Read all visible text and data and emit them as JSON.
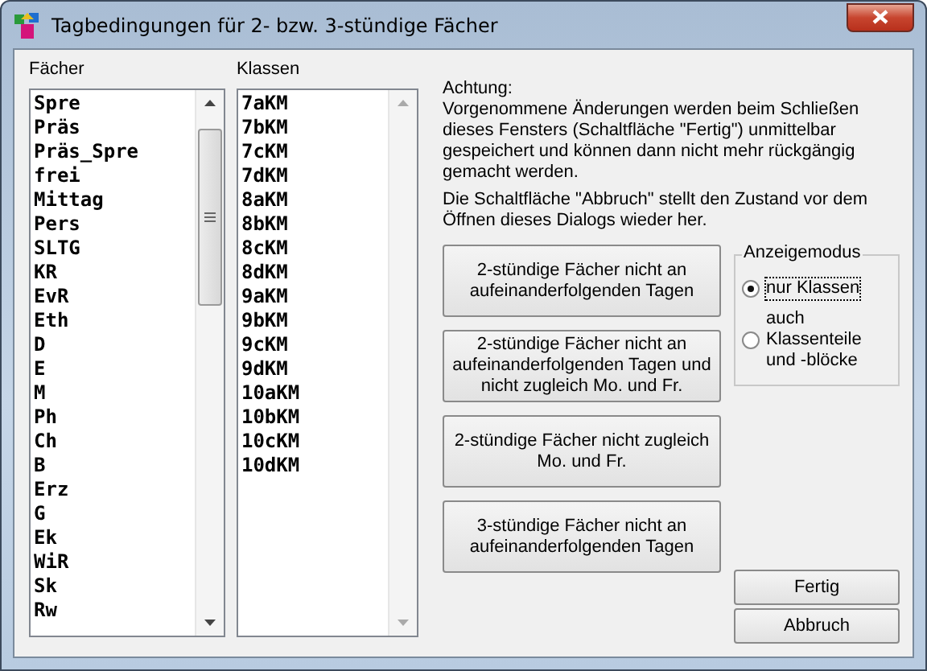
{
  "window": {
    "title": "Tagbedingungen für 2- bzw. 3-stündige Fächer"
  },
  "subjects": {
    "label": "Fächer",
    "items": [
      "Spre",
      "Präs",
      "Präs_Spre",
      "frei",
      "Mittag",
      "Pers",
      "SLTG",
      "KR",
      "EvR",
      "Eth",
      "D",
      "E",
      "M",
      "Ph",
      "Ch",
      "B",
      "Erz",
      "G",
      "Ek",
      "WiR",
      "Sk",
      "Rw"
    ]
  },
  "classes": {
    "label": "Klassen",
    "items": [
      "7aKM",
      "7bKM",
      "7cKM",
      "7dKM",
      "8aKM",
      "8bKM",
      "8cKM",
      "8dKM",
      "9aKM",
      "9bKM",
      "9cKM",
      "9dKM",
      "10aKM",
      "10bKM",
      "10cKM",
      "10dKM"
    ]
  },
  "notice": [
    "Achtung:\nVorgenommene Änderungen werden beim Schließen dieses Fensters (Schaltfläche \"Fertig\") unmittelbar gespeichert und können dann nicht mehr rückgängig gemacht werden.",
    "Die Schaltfläche \"Abbruch\" stellt den Zustand vor dem Öffnen dieses Dialogs wieder her."
  ],
  "actions": [
    "2-stündige Fächer nicht an aufeinanderfolgenden Tagen",
    "2-stündige Fächer nicht an aufeinanderfolgenden Tagen und nicht zugleich Mo. und Fr.",
    "2-stündige Fächer nicht zugleich Mo. und Fr.",
    "3-stündige Fächer nicht an aufeinanderfolgenden Tagen"
  ],
  "display_mode": {
    "label": "Anzeigemodus",
    "options": [
      {
        "label": "nur Klassen",
        "selected": true
      },
      {
        "label": "auch Klassenteile und -blöcke",
        "selected": false
      }
    ]
  },
  "buttons": [
    "Fertig",
    "Abbruch"
  ]
}
